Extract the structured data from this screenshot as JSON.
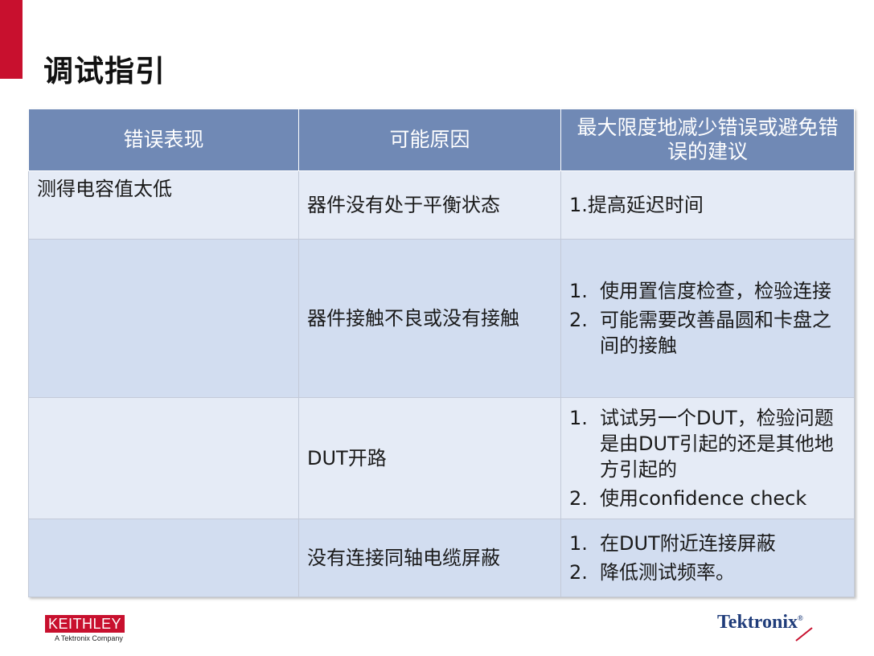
{
  "slide": {
    "title": "调试指引"
  },
  "table": {
    "headers": [
      "错误表现",
      "可能原因",
      "最大限度地减少错误或避免错误的建议"
    ],
    "rows": [
      {
        "symptom": "测得电容值太低",
        "cause": "器件没有处于平衡状态",
        "suggestion": "1.提高延迟时间"
      },
      {
        "symptom": "",
        "cause": "器件接触不良或没有接触",
        "suggestions": [
          "使用置信度检查，检验连接",
          "可能需要改善晶圆和卡盘之间的接触"
        ]
      },
      {
        "symptom": "",
        "cause": "DUT开路",
        "suggestions": [
          "试试另一个DUT，检验问题是由DUT引起的还是其他地方引起的",
          "使用confidence check"
        ]
      },
      {
        "symptom": "",
        "cause": "没有连接同轴电缆屏蔽",
        "suggestions": [
          "在DUT附近连接屏蔽",
          "降低测试频率。"
        ]
      }
    ]
  },
  "logos": {
    "keithley": "KEITHLEY",
    "keithley_tagline": "A Tektronix Company",
    "tektronix": "Tektronix"
  },
  "colors": {
    "accent_red": "#c8102e",
    "header_blue": "#7089b5",
    "row_light": "#e5ebf6",
    "row_dark": "#d2ddf0"
  }
}
